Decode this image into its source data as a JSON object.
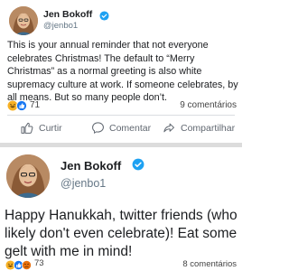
{
  "post1": {
    "author_name": "Jen Bokoff",
    "author_handle": "@jenbo1",
    "text": "This is your annual reminder that not everyone celebrates Christmas! The default to “Merry Christmas” as a normal greeting is also white supremacy culture at work. If someone celebrates, by all means. But so many people don’t.",
    "reaction_count": "71",
    "comment_count": "9 comentários",
    "actions": {
      "like": "Curtir",
      "comment": "Comentar",
      "share": "Compartilhar"
    }
  },
  "post2": {
    "author_name": "Jen Bokoff",
    "author_handle": "@jenbo1",
    "text": "Happy Hanukkah, twitter friends (who likely don't even celebrate)! Eat some gelt with me in mind!",
    "reaction_count": "73",
    "comment_count": "8 comentários"
  },
  "colors": {
    "verified": "#1da1f2",
    "like": "#1877f2",
    "haha": "#f7b125",
    "angry": "#e9710f"
  }
}
